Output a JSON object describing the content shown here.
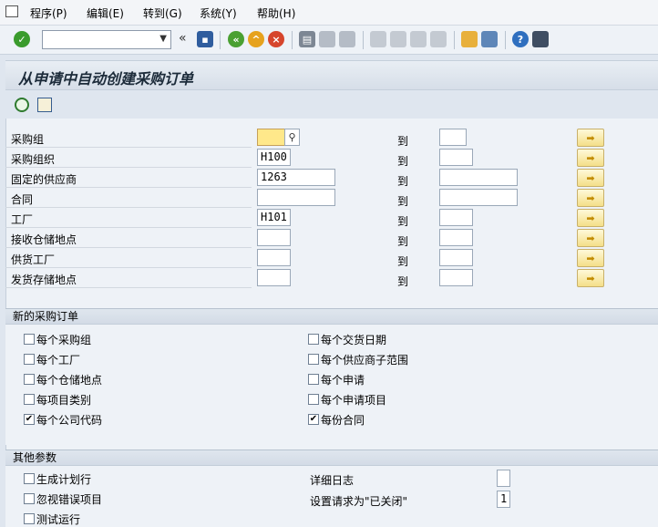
{
  "menu": {
    "program": "程序(P)",
    "edit": "编辑(E)",
    "goto": "转到(G)",
    "system": "系统(Y)",
    "help": "帮助(H)"
  },
  "title": "从申请中自动创建采购订单",
  "fields": [
    {
      "label": "采购组",
      "from": "",
      "to_label": "到",
      "to": ""
    },
    {
      "label": "采购组织",
      "from": "H100",
      "to_label": "到",
      "to": ""
    },
    {
      "label": "固定的供应商",
      "from": "1263",
      "to_label": "到",
      "to": ""
    },
    {
      "label": "合同",
      "from": "",
      "to_label": "到",
      "to": ""
    },
    {
      "label": "工厂",
      "from": "H101",
      "to_label": "到",
      "to": ""
    },
    {
      "label": "接收仓储地点",
      "from": "",
      "to_label": "到",
      "to": ""
    },
    {
      "label": "供货工厂",
      "from": "",
      "to_label": "到",
      "to": ""
    },
    {
      "label": "发货存储地点",
      "from": "",
      "to_label": "到",
      "to": ""
    }
  ],
  "new_po": {
    "title": "新的采购订单",
    "left": [
      {
        "label": "每个采购组",
        "checked": false
      },
      {
        "label": "每个工厂",
        "checked": false
      },
      {
        "label": "每个仓储地点",
        "checked": false
      },
      {
        "label": "每项目类别",
        "checked": false
      },
      {
        "label": "每个公司代码",
        "checked": true
      }
    ],
    "right": [
      {
        "label": "每个交货日期",
        "checked": false
      },
      {
        "label": "每个供应商子范围",
        "checked": false
      },
      {
        "label": "每个申请",
        "checked": false
      },
      {
        "label": "每个申请项目",
        "checked": false
      },
      {
        "label": "每份合同",
        "checked": true
      }
    ]
  },
  "other": {
    "title": "其他参数",
    "left": [
      {
        "label": "生成计划行",
        "checked": false
      },
      {
        "label": "忽视错误项目",
        "checked": false
      },
      {
        "label": "测试运行",
        "checked": false
      }
    ],
    "detail_log_label": "详细日志",
    "detail_log_value": "",
    "set_closed_label": "设置请求为\"已关闭\"",
    "set_closed_value": "1"
  },
  "colors": {
    "accent_green": "#3a9b2d",
    "select_button": "#f4df89",
    "required_field": "#ffe88a"
  }
}
